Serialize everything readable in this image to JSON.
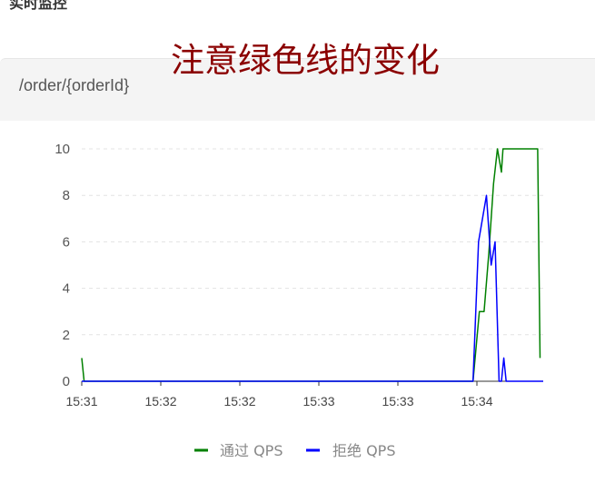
{
  "section": {
    "title": "实时监控"
  },
  "annotation": {
    "text": "注意绿色线的变化"
  },
  "panel": {
    "route": "/order/{orderId}"
  },
  "colors": {
    "pass": "#008000",
    "block": "#0000ff",
    "annotation": "#8b0000"
  },
  "chart_data": {
    "type": "line",
    "x_tick_labels": [
      "15:31",
      "15:32",
      "15:32",
      "15:33",
      "15:33",
      "15:34"
    ],
    "ylim": [
      0,
      10
    ],
    "yticks": [
      0,
      2,
      4,
      6,
      8,
      10
    ],
    "grid": true,
    "legend": "bottom-center",
    "xlim": [
      0,
      5.85
    ],
    "series": [
      {
        "name": "通过 QPS",
        "color": "#008000",
        "x": [
          0,
          0.03,
          0.2,
          1,
          2,
          3,
          4,
          4.88,
          4.96,
          5.04,
          5.1,
          5.16,
          5.22,
          5.27,
          5.32,
          5.34,
          5.38,
          5.48,
          5.6,
          5.7,
          5.78,
          5.81
        ],
        "y": [
          1,
          0,
          0,
          0,
          0,
          0,
          0,
          0,
          0,
          3,
          3,
          5.5,
          8.5,
          10,
          9,
          10,
          10,
          10,
          10,
          10,
          10,
          1
        ]
      },
      {
        "name": "拒绝 QPS",
        "color": "#0000ff",
        "x": [
          0,
          1,
          2,
          3,
          4,
          4.96,
          5.03,
          5.13,
          5.19,
          5.24,
          5.29,
          5.32,
          5.35,
          5.38,
          5.48,
          5.85
        ],
        "y": [
          0,
          0,
          0,
          0,
          0,
          0,
          6,
          8,
          5,
          6,
          0,
          0,
          1,
          0,
          0,
          0
        ]
      }
    ]
  }
}
